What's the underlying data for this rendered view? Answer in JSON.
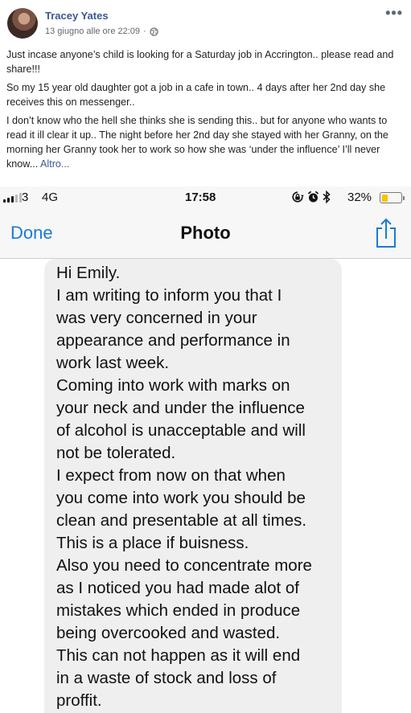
{
  "post": {
    "author": "Tracey Yates",
    "timestamp": "13 giugno alle ore 22:09",
    "separator": "·",
    "paragraphs": [
      "Just incase anyone’s child is looking for a Saturday job in Accrington.. please read and share!!!",
      "So my 15 year old daughter got a job in a cafe in town.. 4 days after her 2nd day she receives this on messenger..",
      "I don’t know who the hell she thinks she is sending this.. but for anyone who wants to read it ill clear it up.. The night before her 2nd day she stayed with her Granny, on the morning her Granny took her to work so how she was ‘under the influence’ I’ll never know..."
    ],
    "more_link": "Altro..."
  },
  "phone": {
    "carrier": "3",
    "network": "4G",
    "time": "17:58",
    "battery_percent_label": "32%",
    "battery_level": 0.32,
    "done_label": "Done",
    "title": "Photo"
  },
  "message_lines": [
    "Hi Emily.",
    "I am writing to inform you that I",
    "was very concerned in your",
    "appearance and performance in",
    "work last week.",
    "Coming into work with marks on",
    "your neck and under the influence",
    "of alcohol is unacceptable and will",
    "not be tolerated.",
    "I expect from now on that when",
    "you come into work you should be",
    "clean and presentable at all times.",
    "This is a place if buisness.",
    "Also you need to concentrate more",
    "as I noticed you had made alot of",
    "mistakes which ended in produce",
    "being overcooked and wasted.",
    "This can not happen as it will end",
    "in a waste of stock and loss of",
    "proffit."
  ],
  "colors": {
    "link_blue": "#385898",
    "ios_blue": "#1b7ad3",
    "battery_yellow": "#f2c500",
    "bubble_gray": "#efefef"
  }
}
